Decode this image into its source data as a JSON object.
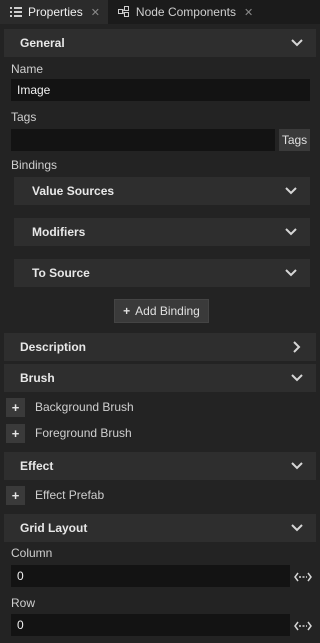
{
  "tabs": [
    {
      "label": "Properties",
      "icon": "list-icon",
      "closable": true
    },
    {
      "label": "Node Components",
      "icon": "node-components-icon",
      "closable": true
    }
  ],
  "general": {
    "title": "General",
    "name_label": "Name",
    "name_value": "Image",
    "tags_label": "Tags",
    "tags_value": "",
    "tags_button": "Tags",
    "bindings_label": "Bindings",
    "binding_sections": [
      "Value Sources",
      "Modifiers",
      "To Source"
    ],
    "add_binding_label": "Add Binding"
  },
  "description": {
    "title": "Description"
  },
  "brush": {
    "title": "Brush",
    "items": [
      "Background Brush",
      "Foreground Brush"
    ]
  },
  "effect": {
    "title": "Effect",
    "items": [
      "Effect Prefab"
    ]
  },
  "grid_layout": {
    "title": "Grid Layout",
    "column_label": "Column",
    "column_value": "0",
    "row_label": "Row",
    "row_value": "0"
  },
  "colors": {
    "panel_bg": "#232323",
    "header_bg": "#2e2e2e",
    "input_bg": "#131313",
    "button_bg": "#3a3a3a"
  }
}
